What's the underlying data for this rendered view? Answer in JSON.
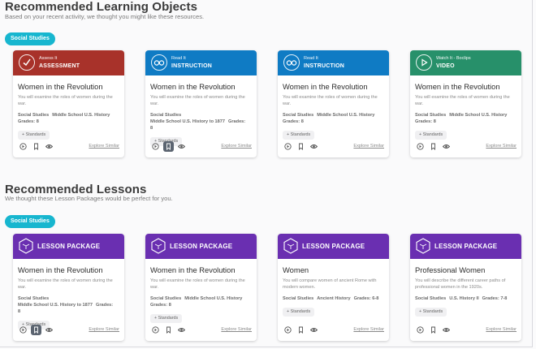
{
  "colors": {
    "assessment": "#a8322a",
    "read": "#0f7bc4",
    "video": "#27906a",
    "lesson": "#6a2fb1",
    "pill": "#17b6cf"
  },
  "learning_objects": {
    "title": "Recommended Learning Objects",
    "subtitle": "Based on your recent activity, we thought you might like these resources.",
    "pill": "Social Studies",
    "cards": [
      {
        "kind": "Assess It",
        "type": "ASSESSMENT",
        "icon": "check-icon",
        "title": "Women in the Revolution",
        "desc": "You will examine the roles of women during the war.",
        "meta1": "Social Studies",
        "meta2": "Middle School U.S. History",
        "meta3": "Grades: 8",
        "standards": "+ Standards",
        "explore": "Explore Similar"
      },
      {
        "kind": "Read It",
        "type": "INSTRUCTION",
        "icon": "glasses-icon",
        "title": "Women in the Revolution",
        "desc": "You will examine the roles of women during the war.",
        "meta1": "Social Studies",
        "meta2": "Middle School U.S. History to 1877",
        "meta3": "Grades: 8",
        "standards": "+ Standards",
        "explore": "Explore Similar"
      },
      {
        "kind": "Read It",
        "type": "INSTRUCTION",
        "icon": "glasses-icon",
        "title": "Women in the Revolution",
        "desc": "You will examine the roles of women during the war.",
        "meta1": "Social Studies",
        "meta2": "Middle School U.S. History",
        "meta3": "Grades: 8",
        "standards": "+ Standards",
        "explore": "Explore Similar"
      },
      {
        "kind": "Watch It - Boclips",
        "type": "VIDEO",
        "icon": "play-icon",
        "title": "Women in the Revolution",
        "desc": "You will examine the roles of women during the war.",
        "meta1": "Social Studies",
        "meta2": "Middle School U.S. History",
        "meta3": "Grades: 8",
        "standards": "+ Standards",
        "explore": "Explore Similar"
      }
    ]
  },
  "lessons": {
    "title": "Recommended Lessons",
    "subtitle": "We thought these Lesson Packages would be perfect for you.",
    "pill": "Social Studies",
    "cards": [
      {
        "type": "LESSON PACKAGE",
        "title": "Women in the Revolution",
        "desc": "You will examine the roles of women during the war.",
        "meta1": "Social Studies",
        "meta2": "Middle School U.S. History to 1877",
        "meta3": "Grades: 8",
        "standards": "+ Standards",
        "explore": "Explore Similar"
      },
      {
        "type": "LESSON PACKAGE",
        "title": "Women in the Revolution",
        "desc": "You will examine the roles of women during the war.",
        "meta1": "Social Studies",
        "meta2": "Middle School U.S. History",
        "meta3": "Grades: 8",
        "standards": "+ Standards",
        "explore": "Explore Similar"
      },
      {
        "type": "LESSON PACKAGE",
        "title": "Women",
        "desc": "You will compare women of ancient Rome with modern women.",
        "meta1": "Social Studies",
        "meta2": "Ancient History",
        "meta3": "Grades: 6-8",
        "standards": "+ Standards",
        "explore": "Explore Similar"
      },
      {
        "type": "LESSON PACKAGE",
        "title": "Professional Women",
        "desc": "You will describe the different career paths of professional women in the 1920s.",
        "meta1": "Social Studies",
        "meta2": "U.S. History II",
        "meta3": "Grades: 7-8",
        "standards": "+ Standards",
        "explore": "Explore Similar"
      }
    ]
  }
}
